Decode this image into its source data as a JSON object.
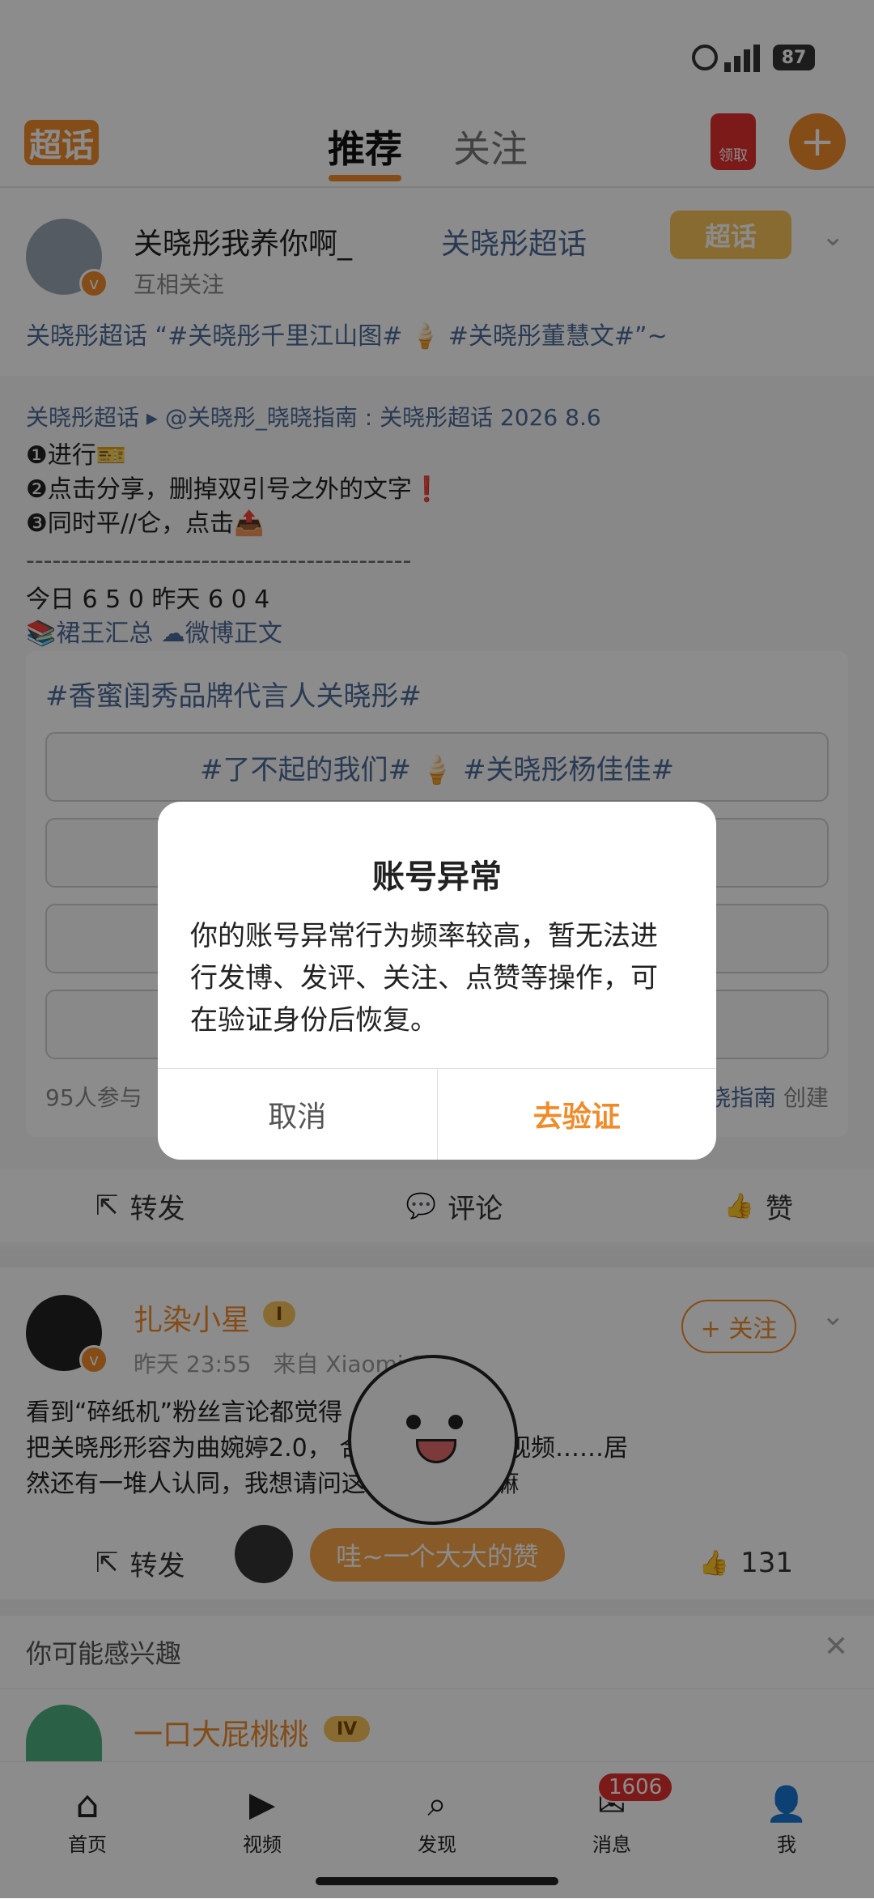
{
  "status_bar": {
    "battery": "87"
  },
  "header": {
    "logo": "超话",
    "tabs": [
      "推荐",
      "关注"
    ],
    "reward_label": "领取",
    "plus": "+"
  },
  "post1": {
    "author": "关晓彤我养你啊_",
    "author_badge": "关晓彤超话",
    "relation": "互相关注",
    "tag_logo": "超话",
    "line_topics": "关晓彤超话 “#关晓彤千里江山图# 🍦 #关晓彤董慧文#”~",
    "quote_head": "关晓彤超话 ▸ @关晓彤_晓晓指南 : 关晓彤超话  2026 8.6",
    "steps": [
      "❶进行🎫",
      "❷点击分享，删掉双引号之外的文字❗",
      "❸同时平//仑，点击📤"
    ],
    "divider": "--------------------------------------------",
    "stats": "今日 6 5 0   昨天 6 0 4",
    "footer_links": "📚裙王汇总 ☁微博正文",
    "box_title": "#香蜜闺秀品牌代言人关晓彤#",
    "box_items": [
      "#了不起的我们# 🍦 #关晓彤杨佳佳#",
      "",
      "",
      ""
    ],
    "box_footer_left": "95人参与",
    "box_footer_right_link": "晓指南",
    "box_footer_right": "创建",
    "actions": {
      "repost": "转发",
      "comment": "评论",
      "like": "赞"
    }
  },
  "post2": {
    "author": "扎染小星",
    "level": "I",
    "time": "昨天 23:55",
    "source": "来自 Xiaomi 1",
    "follow": "+ 关注",
    "text_lines": [
      "看到“碎纸机”粉丝言论都觉得",
      "把关晓彤形容为曲婉婷2.0，        合作ai出了那些视频……居",
      "然还有一堆人认同，我想请问这        还有正常人嘛"
    ],
    "actions": {
      "repost": "转发",
      "like_count": "131"
    },
    "cheer": "哇~一个大大的赞"
  },
  "suggest": {
    "title": "你可能感兴趣",
    "user": "一口大屁桃桃",
    "level": "IV"
  },
  "tabbar": {
    "items": [
      {
        "label": "首页"
      },
      {
        "label": "视频"
      },
      {
        "label": "发现"
      },
      {
        "label": "消息",
        "badge": "1606"
      },
      {
        "label": "我"
      }
    ]
  },
  "dialog": {
    "title": "账号异常",
    "message": "你的账号异常行为频率较高，暂无法进行发博、发评、关注、点赞等操作，可在验证身份后恢复。",
    "cancel": "取消",
    "verify": "去验证"
  },
  "colors": {
    "accent": "#f08b2a",
    "topic_blue": "#4c6a9a",
    "badge_red": "#e0302e"
  }
}
